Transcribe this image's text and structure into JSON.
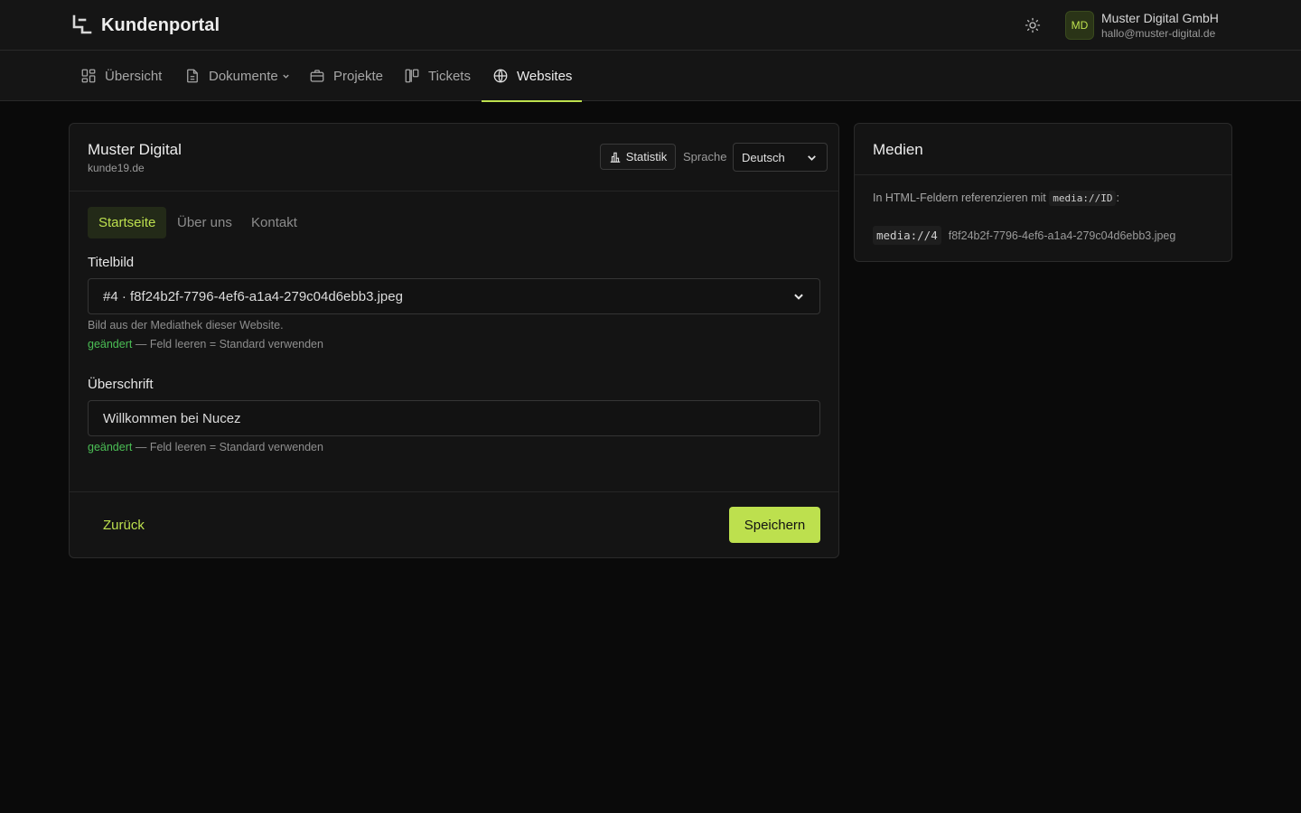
{
  "app": {
    "title": "Kundenportal"
  },
  "user": {
    "initials": "MD",
    "name": "Muster Digital GmbH",
    "email": "hallo@muster-digital.de"
  },
  "nav": {
    "items": [
      {
        "label": "Übersicht"
      },
      {
        "label": "Dokumente"
      },
      {
        "label": "Projekte"
      },
      {
        "label": "Tickets"
      },
      {
        "label": "Websites"
      }
    ],
    "active": "Websites"
  },
  "site": {
    "name": "Muster Digital",
    "domain": "kunde19.de",
    "stats_label": "Statistik",
    "language_label": "Sprache",
    "language_value": "Deutsch"
  },
  "tabs": [
    {
      "label": "Startseite"
    },
    {
      "label": "Über uns"
    },
    {
      "label": "Kontakt"
    }
  ],
  "fields": {
    "title_image": {
      "label": "Titelbild",
      "value": "#4 · f8f24b2f-7796-4ef6-a1a4-279c04d6ebb3.jpeg",
      "help": "Bild aus der Mediathek dieser Website.",
      "changed": "geändert",
      "changed_hint": "— Feld leeren = Standard verwenden"
    },
    "heading": {
      "label": "Überschrift",
      "value": "Willkommen bei Nucez",
      "changed": "geändert",
      "changed_hint": "— Feld leeren = Standard verwenden"
    }
  },
  "actions": {
    "back": "Zurück",
    "save": "Speichern"
  },
  "media": {
    "title": "Medien",
    "hint_prefix": "In HTML-Feldern referenzieren mit",
    "hint_code": "media://ID",
    "hint_suffix": ":",
    "items": [
      {
        "ref": "media://4",
        "file": "f8f24b2f-7796-4ef6-a1a4-279c04d6ebb3.jpeg"
      }
    ]
  },
  "colors": {
    "accent": "#bde04e",
    "changed": "#4bbf55",
    "background": "#0a0a0a",
    "surface": "#141414"
  }
}
